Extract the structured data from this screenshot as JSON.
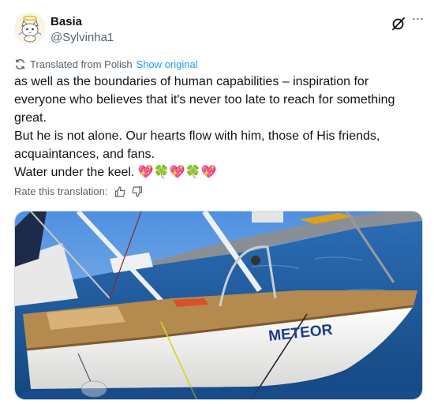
{
  "author": {
    "name": "Basia",
    "handle": "@Sylvinha1",
    "avatar_icon": "cat-angel-avatar"
  },
  "header_actions": {
    "grok_icon": "grok-icon",
    "more_icon": "more-icon"
  },
  "translation": {
    "label": "Translated from Polish",
    "show_original": "Show original"
  },
  "tweet": {
    "text": "as well as the boundaries of human capabilities – inspiration for\neveryone who believes that it's never too late to reach for something\ngreat.\nBut he is not alone. Our hearts flow with him, those of His friends,\nacquaintances, and fans.\nWater under the keel. 💖🍀💖🍀💖"
  },
  "rating": {
    "label": "Rate this translation:",
    "up_icon": "thumbs-up-icon",
    "down_icon": "thumbs-down-icon"
  },
  "media": {
    "boat_name": "METEOR",
    "colors": {
      "sky": "#5e9ee6",
      "sea": "#1d5ea8",
      "hull": "#f2f2f0",
      "deck": "#b58a4e",
      "hull_letters": "#1f3b8c"
    }
  }
}
